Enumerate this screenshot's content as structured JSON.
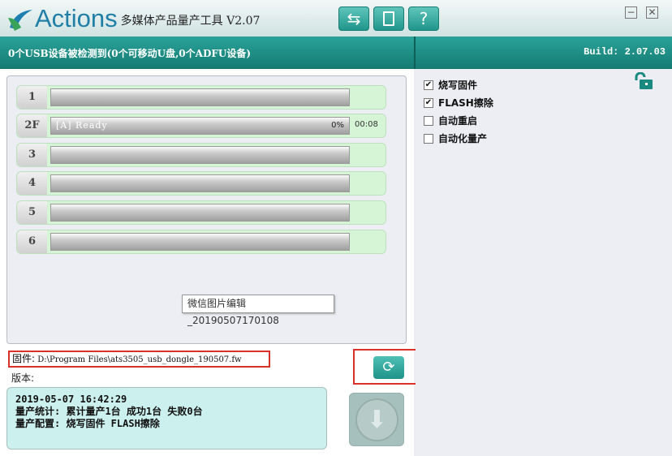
{
  "app": {
    "logo_text": "Actions",
    "title": "多媒体产品量产工具 V2.07"
  },
  "toolbar": {
    "usb": "usb-icon",
    "file": "file-icon",
    "help": "?"
  },
  "window": {
    "minimize": "−",
    "close": "✕"
  },
  "status": {
    "detected": "0个USB设备被检测到(0个可移动U盘,0个ADFU设备)",
    "build": "Build: 2.07.03"
  },
  "slots": [
    {
      "id": "1",
      "text": "",
      "percent": "",
      "time": ""
    },
    {
      "id": "2F",
      "text": "[A] Ready",
      "percent": "0%",
      "time": "00:08"
    },
    {
      "id": "3",
      "text": "",
      "percent": "",
      "time": ""
    },
    {
      "id": "4",
      "text": "",
      "percent": "",
      "time": ""
    },
    {
      "id": "5",
      "text": "",
      "percent": "",
      "time": ""
    },
    {
      "id": "6",
      "text": "",
      "percent": "",
      "time": ""
    }
  ],
  "tooltip": "微信图片编辑_20190507170108",
  "firmware": {
    "label": "固件:",
    "path": "D:\\Program Files\\ats3505_usb_dongle_190507.fw",
    "version_label": "版本:"
  },
  "log": [
    "2019-05-07 16:42:29",
    "量产统计: 累计量产1台 成功1台 失败0台",
    "量产配置: 烧写固件 FLASH擦除"
  ],
  "options": [
    {
      "label": "烧写固件",
      "checked": true
    },
    {
      "label": "FLASH擦除",
      "checked": true
    },
    {
      "label": "自动重启",
      "checked": false
    },
    {
      "label": "自动化量产",
      "checked": false
    }
  ],
  "colors": {
    "accent": "#1f9389",
    "highlight": "#d9302a"
  }
}
